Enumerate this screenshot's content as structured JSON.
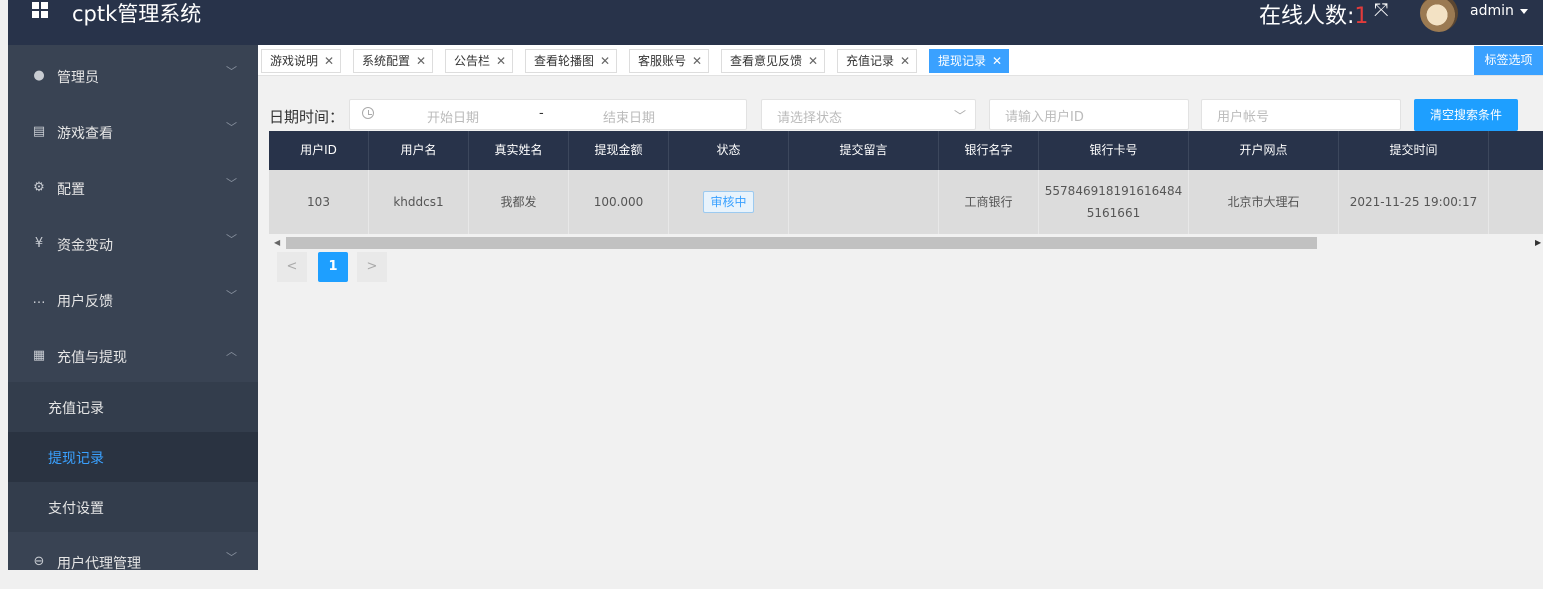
{
  "header": {
    "title": "cptk管理系统",
    "online_label": "在线人数:",
    "online_count": "1",
    "user": "admin"
  },
  "sidebar": {
    "items": [
      {
        "label": "管理员",
        "icon": "user-icon"
      },
      {
        "label": "游戏查看",
        "icon": "monitor-icon"
      },
      {
        "label": "配置",
        "icon": "gear-icon"
      },
      {
        "label": "资金变动",
        "icon": "yen-icon"
      },
      {
        "label": "用户反馈",
        "icon": "chat-icon"
      },
      {
        "label": "充值与提现",
        "icon": "clipboard-icon"
      }
    ],
    "sub_items": [
      {
        "label": "充值记录"
      },
      {
        "label": "提现记录"
      },
      {
        "label": "支付设置"
      }
    ],
    "last_item": {
      "label": "用户代理管理",
      "icon": "link-icon"
    }
  },
  "tabs": [
    {
      "label": "游戏说明"
    },
    {
      "label": "系统配置"
    },
    {
      "label": "公告栏"
    },
    {
      "label": "查看轮播图"
    },
    {
      "label": "客服账号"
    },
    {
      "label": "查看意见反馈"
    },
    {
      "label": "充值记录"
    },
    {
      "label": "提现记录"
    }
  ],
  "tab_options_label": "标签选项",
  "filters": {
    "date_label": "日期时间：",
    "start_placeholder": "开始日期",
    "range_sep": "-",
    "end_placeholder": "结束日期",
    "status_placeholder": "请选择状态",
    "user_id_placeholder": "请输入用户ID",
    "account_placeholder": "用户帐号",
    "clear_button": "清空搜索条件"
  },
  "table": {
    "columns": [
      "用户ID",
      "用户名",
      "真实姓名",
      "提现金额",
      "状态",
      "提交留言",
      "银行名字",
      "银行卡号",
      "开户网点",
      "提交时间"
    ],
    "rows": [
      {
        "user_id": "103",
        "username": "khddcs1",
        "real_name": "我都发",
        "amount": "100.000",
        "status": "审核中",
        "message": "",
        "bank_name": "工商银行",
        "card_line1": "557846918191616484",
        "card_line2": "5161661",
        "branch": "北京市大理石",
        "submit_time": "2021-11-25 19:00:17"
      }
    ]
  },
  "pager": {
    "current": "1",
    "prev": "<",
    "next": ">"
  },
  "colors": {
    "header_bg": "#28334a",
    "sidebar_bg": "#394353",
    "accent": "#1e9fff"
  }
}
